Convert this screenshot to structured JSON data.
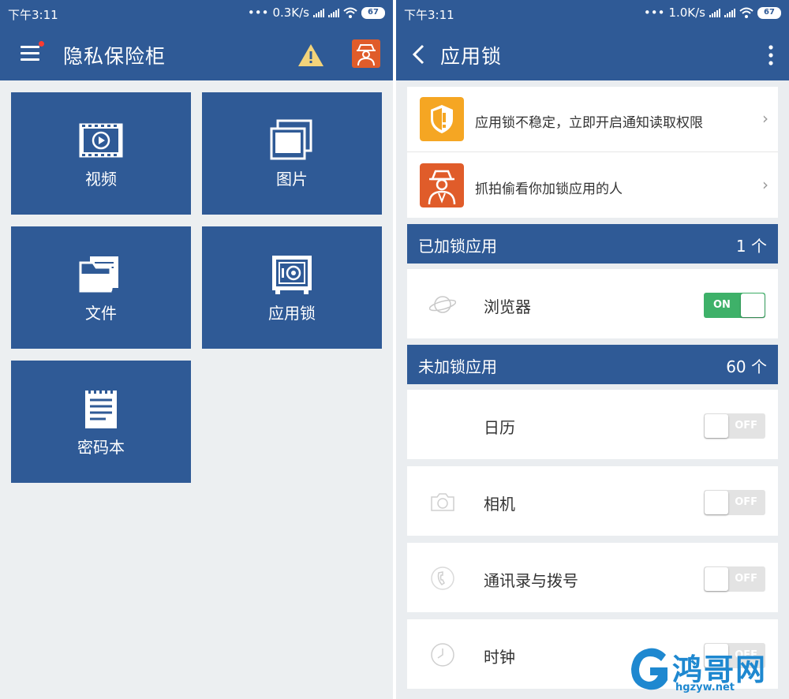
{
  "left_screen": {
    "status": {
      "time": "下午3:11",
      "speed": "0.3K/s",
      "battery": "67"
    },
    "title": "隐私保险柜",
    "tiles": [
      {
        "label": "视频",
        "icon": "video-film-icon"
      },
      {
        "label": "图片",
        "icon": "pictures-icon"
      },
      {
        "label": "文件",
        "icon": "folder-icon"
      },
      {
        "label": "应用锁",
        "icon": "safe-icon"
      },
      {
        "label": "密码本",
        "icon": "notepad-icon"
      }
    ]
  },
  "right_screen": {
    "status": {
      "time": "下午3:11",
      "speed": "1.0K/s",
      "battery": "67"
    },
    "title": "应用锁",
    "notices": [
      {
        "text": "应用锁不稳定，立即开启通知读取权限",
        "icon": "shield-warning-icon"
      },
      {
        "text": "抓拍偷看你加锁应用的人",
        "icon": "spy-icon"
      }
    ],
    "locked_section": {
      "name": "已加锁应用",
      "count": "1 个"
    },
    "locked_apps": [
      {
        "name": "浏览器",
        "state": "ON",
        "icon": "browser-planet-icon"
      }
    ],
    "unlocked_section": {
      "name": "未加锁应用",
      "count": "60 个"
    },
    "unlocked_apps": [
      {
        "name": "日历",
        "state": "OFF",
        "icon": "calendar-icon"
      },
      {
        "name": "相机",
        "state": "OFF",
        "icon": "camera-icon"
      },
      {
        "name": "通讯录与拨号",
        "state": "OFF",
        "icon": "phone-icon"
      },
      {
        "name": "时钟",
        "state": "OFF",
        "icon": "clock-icon"
      }
    ]
  },
  "watermark": {
    "text": "鸿哥网",
    "url": "hgzyw.net"
  },
  "colors": {
    "primary": "#2f5a96",
    "toggle_on": "#3eb169",
    "warning": "#f5a623",
    "spy_icon": "#e05c2a"
  }
}
